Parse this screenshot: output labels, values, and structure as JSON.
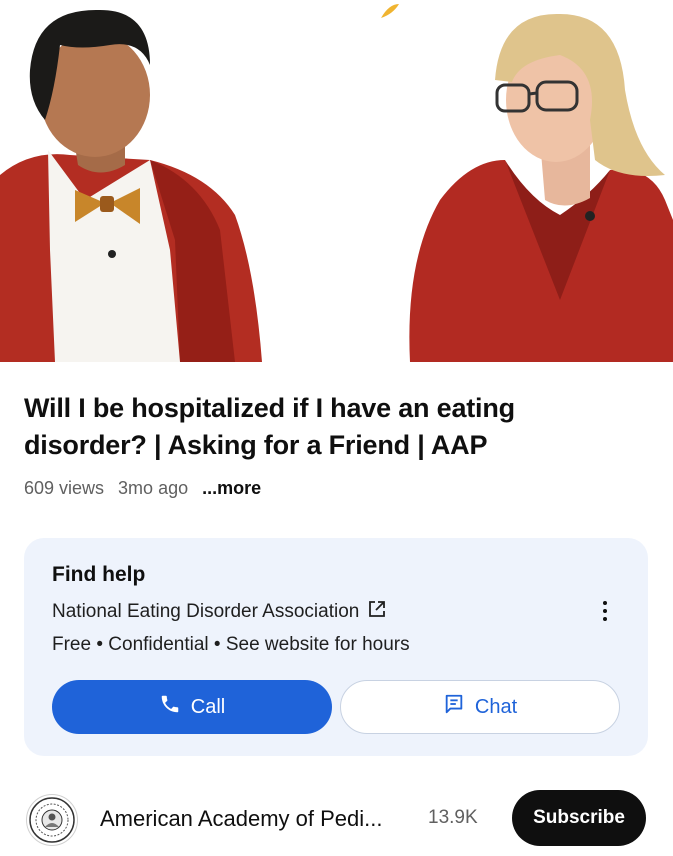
{
  "video": {
    "title": "Will I be hospitalized if I have an eating disorder?  | Asking for a Friend | AAP",
    "views": "609 views",
    "age": "3mo ago",
    "more_label": "...more"
  },
  "help_card": {
    "title": "Find help",
    "organization": "National Eating Disorder Association",
    "details": "Free • Confidential • See website for hours",
    "call_label": "Call",
    "chat_label": "Chat"
  },
  "channel": {
    "name": "American Academy of Pedi...",
    "subscribers": "13.9K",
    "subscribe_label": "Subscribe"
  },
  "colors": {
    "accent": "#1f63d9",
    "card_bg": "#eef3fc",
    "subscribe_bg": "#0f0f0f",
    "meta_text": "#606060"
  },
  "icons": {
    "call": "phone-icon",
    "chat": "chat-bubble-icon",
    "external": "external-link-icon",
    "menu": "more-vert-icon",
    "avatar": "aap-seal-logo"
  }
}
